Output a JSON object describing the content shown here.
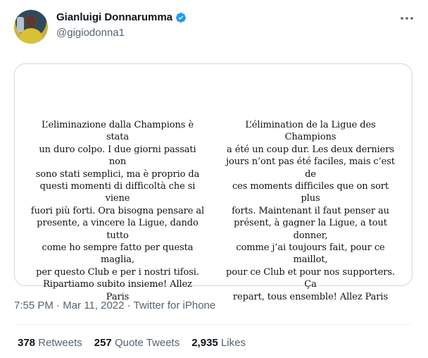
{
  "author": {
    "display_name": "Gianluigi Donnarumma",
    "handle": "@gigiodonna1",
    "verified": true
  },
  "tweet": {
    "image_text": {
      "italian": [
        "L’eliminazione dalla Champions è stata",
        "un duro colpo. I due giorni passati non",
        "sono stati semplici, ma è proprio da",
        "questi momenti di difficoltà che si viene",
        "fuori più forti. Ora bisogna pensare al",
        "presente, a vincere la Ligue, dando tutto",
        "come ho sempre fatto per questa maglia,",
        "per questo Club e per i nostri tifosi.",
        "Ripartiamo subito insieme! Allez Paris"
      ],
      "french": [
        "L’élimination de la Ligue des Champions",
        "a été un coup dur. Les deux derniers",
        "jours n’ont pas été faciles, mais c’est de",
        "ces moments difficiles que on sort plus",
        "forts. Maintenant il faut penser au",
        "présent, à gagner la Ligue, a tout donner,",
        "comme j’ai toujours fait, pour ce maillot,",
        "pour ce Club et pour nos supporters. Ça",
        "repart, tous ensemble! Allez Paris"
      ]
    },
    "meta": "7:55 PM · Mar 11, 2022 · Twitter for iPhone"
  },
  "stats": [
    {
      "number": "378",
      "label": "Retweets"
    },
    {
      "number": "257",
      "label": "Quote Tweets"
    },
    {
      "number": "2,935",
      "label": "Likes"
    }
  ],
  "icons": {
    "verified": "verified-badge-icon",
    "more": "more-horizontal-icon"
  },
  "colors": {
    "verified_blue": "#1d9bf0",
    "secondary_text": "#536471",
    "border": "#cfd9de"
  }
}
